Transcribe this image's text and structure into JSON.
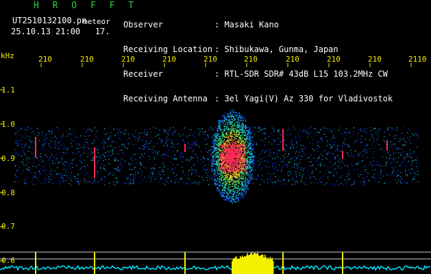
{
  "header": {
    "brand": "H R O F F T",
    "filename": "UT2510132100.pn",
    "meteor_label": "meteor",
    "timestamp": "25.10.13 21:00   17.",
    "meta_keys": [
      "Observer",
      "Receiving Location",
      "Receiver",
      "Receiving Antenna"
    ],
    "meta_values": [
      ": Masaki Kano",
      ": Shibukawa, Gunma, Japan",
      ": RTL-SDR SDR# 43dB L15 103.2MHz CW",
      ": 3el Yagi(V) Az 330 for Vladivostok"
    ]
  },
  "axes": {
    "unit": "kHz",
    "x_ticks": [
      "210",
      "210",
      "210",
      "210",
      "210",
      "210",
      "210",
      "210",
      "210",
      "2110"
    ],
    "y_ticks": [
      "1.1",
      "1.0",
      "0.9",
      "0.8",
      "0.7",
      "0.6"
    ]
  },
  "colors": {
    "background": "#000000",
    "label_green": "#2fd13a",
    "tick_yellow": "#f4f000",
    "baseline_cyan": "#00e5ff",
    "noise_blue": "#1a2fd0",
    "echo_red": "#ff2a5a"
  },
  "spectrogram": {
    "echo_center_x_fraction": 0.57,
    "band_center_khz": 0.91
  }
}
